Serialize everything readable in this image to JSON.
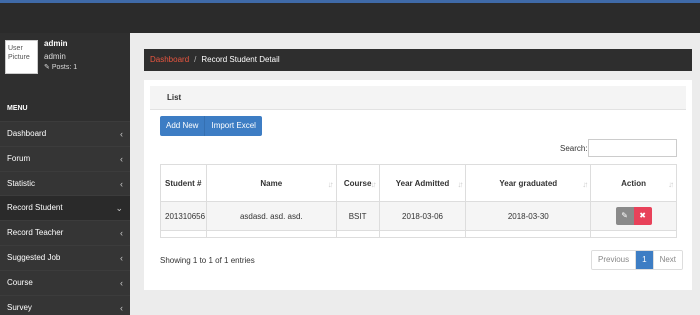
{
  "profile": {
    "avatar_alt": "User Picture",
    "username": "admin",
    "role": "admin",
    "posts": "Posts: 1"
  },
  "menu": {
    "title": "MENU",
    "items": [
      {
        "label": "Dashboard",
        "chevron": "‹"
      },
      {
        "label": "Forum",
        "chevron": "‹"
      },
      {
        "label": "Statistic",
        "chevron": "‹"
      },
      {
        "label": "Record Student",
        "chevron": "⌄"
      },
      {
        "label": "Record Teacher",
        "chevron": "‹"
      },
      {
        "label": "Suggested Job",
        "chevron": "‹"
      },
      {
        "label": "Course",
        "chevron": "‹"
      },
      {
        "label": "Survey",
        "chevron": "‹"
      }
    ]
  },
  "breadcrumb": {
    "link": "Dashboard",
    "separator": "/",
    "current": "Record Student Detail"
  },
  "panel": {
    "title": "List"
  },
  "buttons": {
    "add_new": "Add New",
    "import_excel": "Import Excel"
  },
  "search": {
    "label": "Search:",
    "value": ""
  },
  "table": {
    "headers": {
      "student_no": "Student #",
      "name": "Name",
      "course": "Course",
      "year_admitted": "Year Admitted",
      "year_graduated": "Year graduated",
      "action": "Action"
    },
    "rows": [
      {
        "student_no": "201310656",
        "name": "asdasd. asd. asd.",
        "course": "BSIT",
        "year_admitted": "2018-03-06",
        "year_graduated": "2018-03-30"
      }
    ]
  },
  "footer": {
    "entries": "Showing 1 to 1 of 1 entries"
  },
  "pagination": {
    "previous": "Previous",
    "page": "1",
    "next": "Next"
  },
  "colors": {
    "primary": "#3d7dc4",
    "danger": "#e8425a",
    "breadcrumb_link": "#e8553f",
    "topbar_accent": "#3f6aa8"
  },
  "icons": {
    "edit": "edit-icon",
    "delete": "close-icon",
    "posts": "edit-icon",
    "sort": "sort-icon"
  }
}
